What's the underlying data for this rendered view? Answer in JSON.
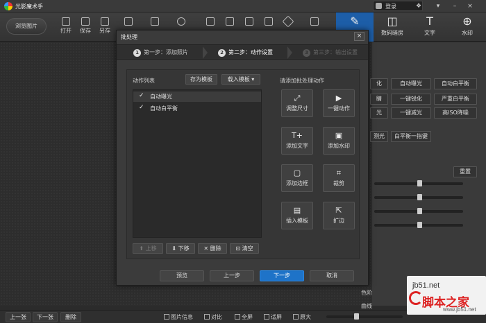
{
  "app": {
    "title": "光影魔术手",
    "login": "登录"
  },
  "toolbar": {
    "browse": "浏览图片",
    "tools": [
      {
        "label": "打开"
      },
      {
        "label": "保存"
      },
      {
        "label": "另存"
      }
    ],
    "tabs": [
      {
        "label": "",
        "glyph": "✎"
      },
      {
        "label": "数码暗房",
        "glyph": "◫"
      },
      {
        "label": "文字",
        "glyph": "T"
      },
      {
        "label": "水印",
        "glyph": "⊕"
      }
    ]
  },
  "dialog": {
    "title": "批处理",
    "close": "×",
    "steps": [
      {
        "num": "1",
        "label": "第一步：添加照片"
      },
      {
        "num": "2",
        "label": "第二步：动作设置"
      },
      {
        "num": "3",
        "label": "第三步：输出设置"
      }
    ],
    "list_label": "动作列表",
    "save_template": "存为模板",
    "load_template": "载入模板",
    "actions": [
      {
        "check": "✓",
        "label": "自动曝光"
      },
      {
        "check": "✓",
        "label": "自动白平衡"
      }
    ],
    "list_buttons": {
      "up": "上移",
      "down": "下移",
      "delete": "删除",
      "clear": "清空"
    },
    "add_label": "请添加批处理动作",
    "add_buttons": [
      {
        "glyph": "⤢",
        "label": "调整尺寸"
      },
      {
        "glyph": "▶",
        "label": "一键动作"
      },
      {
        "glyph": "T+",
        "label": "添加文字"
      },
      {
        "glyph": "▣",
        "label": "添加水印"
      },
      {
        "glyph": "▢",
        "label": "添加边框"
      },
      {
        "glyph": "⌗",
        "label": "裁剪"
      },
      {
        "glyph": "▤",
        "label": "插入模板"
      },
      {
        "glyph": "⇱",
        "label": "扩边"
      }
    ],
    "footer": {
      "preview": "预览",
      "prev": "上一步",
      "next": "下一步",
      "cancel": "取消"
    }
  },
  "right_panel": {
    "buttons": [
      "化",
      "自动曝光",
      "自动白平衡",
      "睛",
      "一键锐化",
      "严重白平衡",
      "光",
      "一键减光",
      "高ISO降噪",
      "测光",
      "白平衡一指键"
    ],
    "reset": "重置",
    "labels": [
      "色阶",
      "曲线"
    ],
    "slider_levels": [
      0.51,
      0.51,
      0.51,
      0.51
    ]
  },
  "bottom": {
    "prev": "上一张",
    "next": "下一张",
    "delete": "删除",
    "items": [
      "图片信息",
      "对比",
      "全屏",
      "适屏",
      "原大"
    ]
  },
  "watermark": {
    "site": "jb51.net",
    "name": "脚本之家",
    "url": "www.jb51.net"
  },
  "colors": {
    "accent": "#1e73c8",
    "tab_active": "#1d5ea8"
  }
}
